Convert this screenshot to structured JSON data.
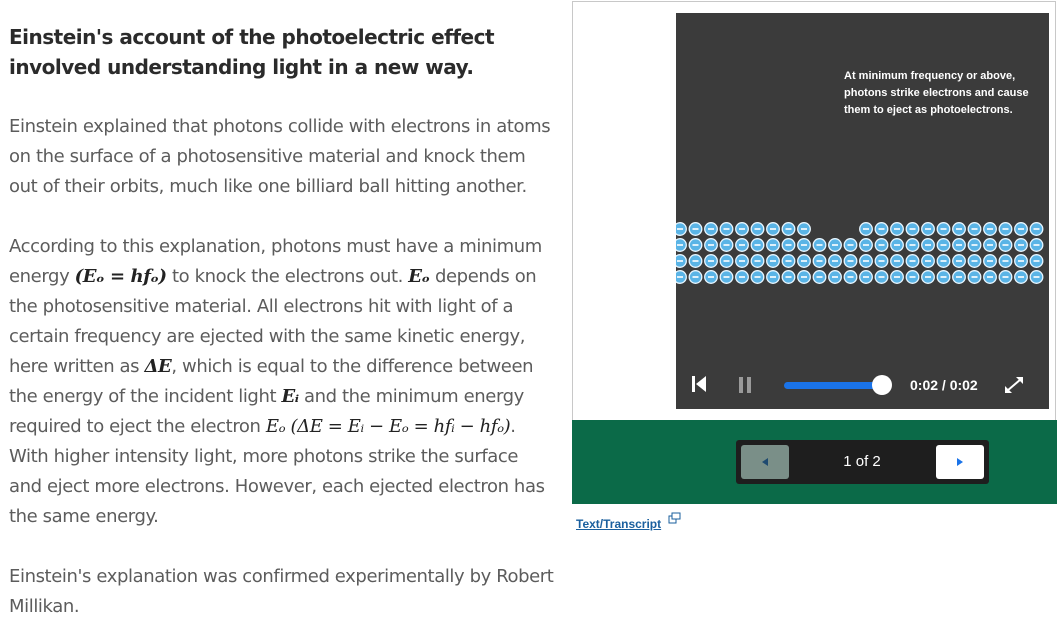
{
  "article": {
    "heading": "Einstein's account of the photoelectric effect involved understanding light in a new way.",
    "p1": "Einstein explained that photons collide with electrons in atoms on the surface of a photosensitive material and knock them out of their orbits, much like one billiard ball hitting another.",
    "p2_a": "According to this explanation, photons must have a minimum energy ",
    "p2_eq1": "(Eₒ = hfₒ)",
    "p2_b": " to knock the electrons out. ",
    "p2_eo": "Eₒ",
    "p2_c": " depends on the photosensitive material. All electrons hit with light of a certain frequency are ejected with the same kinetic energy, here written as ",
    "p2_de": "ΔE",
    "p2_d": ", which is equal to the difference between the energy of the incident light ",
    "p2_ei": "Eᵢ",
    "p2_e": " and the minimum energy required to eject the electron ",
    "p2_eq2": "Eₒ (ΔE = Eᵢ −  Eₒ = hfᵢ  − hfₒ)",
    "p2_f": ". With higher intensity light, more photons strike the surface and eject more electrons. However, each ejected electron has the same energy.",
    "p3": "Einstein's explanation was confirmed experimentally by Robert Millikan."
  },
  "video": {
    "caption": "At minimum frequency or above, photons strike electrons and cause them to eject as photoelectrons.",
    "time": "0:02 / 0:02",
    "progress": 1.0,
    "electron_color": "#5ab4e6"
  },
  "pager": {
    "label": "1 of 2"
  },
  "transcript": {
    "label": "Text/Transcript"
  }
}
